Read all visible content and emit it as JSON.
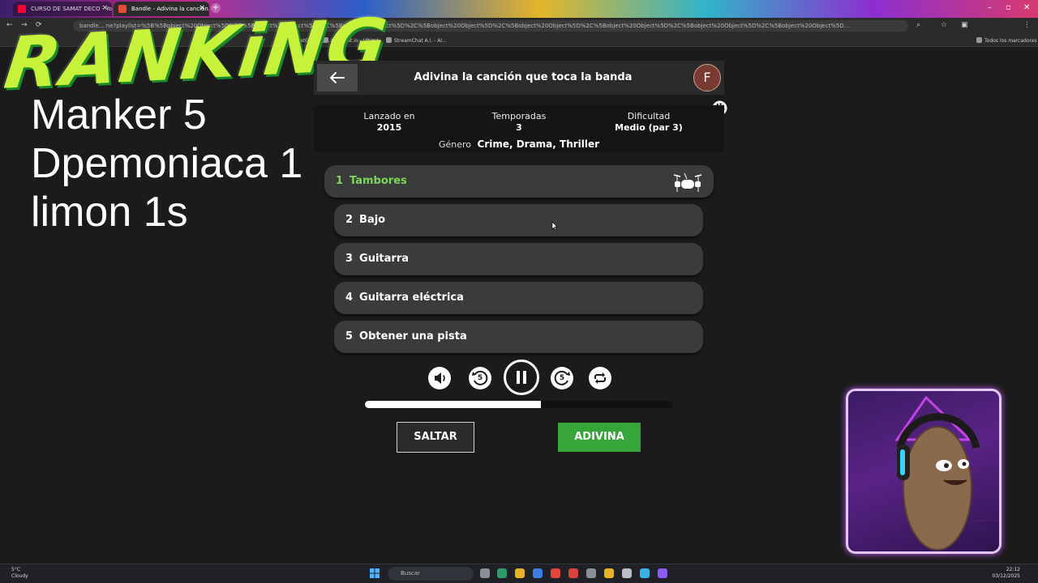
{
  "browser": {
    "tabs": [
      {
        "label": "CURSO DE SAMAT DECO - Yo...",
        "active": false
      },
      {
        "label": "Bandle - Adivina la canción...",
        "active": true
      }
    ],
    "url": "bandle... ne?playlist=%5B%5Bobject%20Object%5D%2C%5Bobject%20Object%5D%2C%5Bobject%20Object%5D%2C%5Bobject%20Object%5D%2C%5Bobject%20Object%5D%2C%5Bobject%20Object%5D%2C%5Bobject%20Object%5D%2C%5Bobject%20Object%5D...",
    "bookmarks": [
      "ChatGPT (Op...",
      "Algochat.io - Ultima...",
      "StreamChat A.I. - AI..."
    ],
    "all_bookmarks": "Todos los marcadores"
  },
  "overlay": {
    "logo_text": "RANKiNG",
    "ranking": [
      "Manker 5",
      "Dpemoniaca 1",
      "limon 1s"
    ]
  },
  "game": {
    "title": "Adivina la canción que toca la banda",
    "avatar_letter": "F",
    "info": {
      "released_label": "Lanzado en",
      "released_value": "2015",
      "seasons_label": "Temporadas",
      "seasons_value": "3",
      "difficulty_label": "Dificultad",
      "difficulty_value": "Medio (par 3)",
      "genre_label": "Género",
      "genre_value": "Crime, Drama, Thriller"
    },
    "hints": [
      {
        "num": "1",
        "label": "Tambores"
      },
      {
        "num": "2",
        "label": "Bajo"
      },
      {
        "num": "3",
        "label": "Guitarra"
      },
      {
        "num": "4",
        "label": "Guitarra eléctrica"
      },
      {
        "num": "5",
        "label": "Obtener una pista"
      }
    ],
    "controls": {
      "rewind_seconds": "5",
      "forward_seconds": "5"
    },
    "progress": 0.57,
    "skip_label": "SALTAR",
    "guess_label": "ADIVINA"
  },
  "taskbar": {
    "weather_temp": "5°C",
    "weather_desc": "Cloudy",
    "search_placeholder": "Buscar",
    "time": "22:12",
    "date": "03/12/2025"
  },
  "colors": {
    "accent_green": "#36a53a",
    "active_hint": "#7bd65a",
    "hint_bg": "#3a3c3c"
  }
}
